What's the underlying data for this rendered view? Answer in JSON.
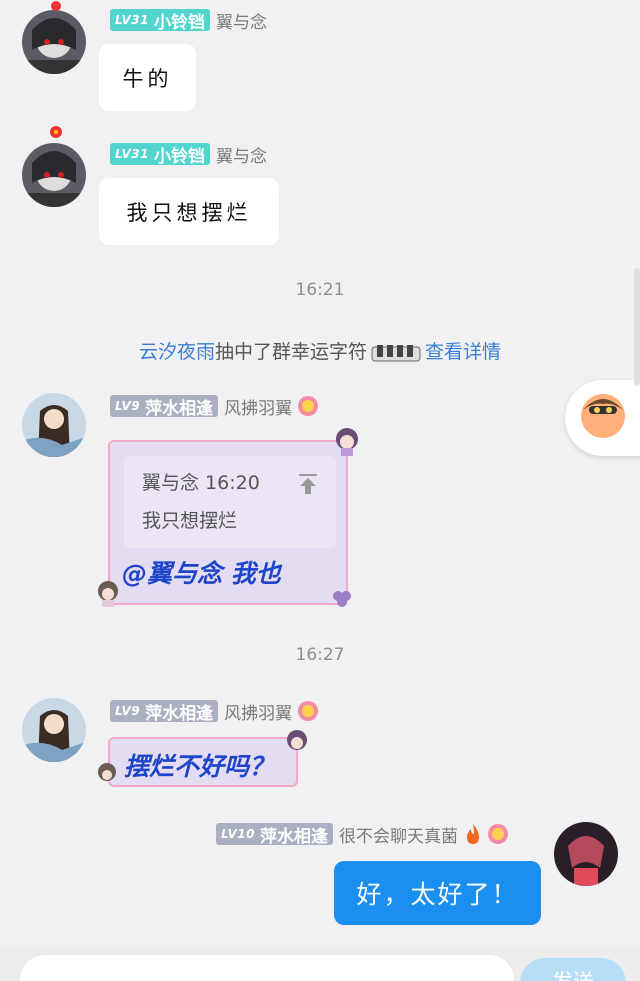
{
  "messages": [
    {
      "level": "LV31",
      "nickname": "小铃铛",
      "title": "翼与念",
      "text": "牛的"
    },
    {
      "level": "LV31",
      "nickname": "小铃铛",
      "title": "翼与念",
      "text": "我只想摆烂"
    },
    {
      "level": "LV9",
      "nickname": "萍水相逢",
      "title": "风拂羽翼",
      "quote_author_time": "翼与念 16:20",
      "quote_text": "我只想摆烂",
      "reply": "@翼与念 我也"
    },
    {
      "level": "LV9",
      "nickname": "萍水相逢",
      "title": "风拂羽翼",
      "text": "摆烂不好吗？"
    },
    {
      "level": "LV10",
      "nickname": "萍水相逢",
      "title": "很不会聊天真菌",
      "text": "好，太好了！"
    }
  ],
  "timestamps": [
    "16:21",
    "16:27"
  ],
  "system": {
    "user": "云汐夜雨",
    "action": "抽中了群幸运字符",
    "link": "查看详情"
  },
  "input": {
    "send_label": "发送"
  },
  "colors": {
    "accent": "#1a8ff0",
    "link": "#3a7fd5",
    "badge_teal": "#52d4cf",
    "badge_gray": "#aab0c2"
  }
}
